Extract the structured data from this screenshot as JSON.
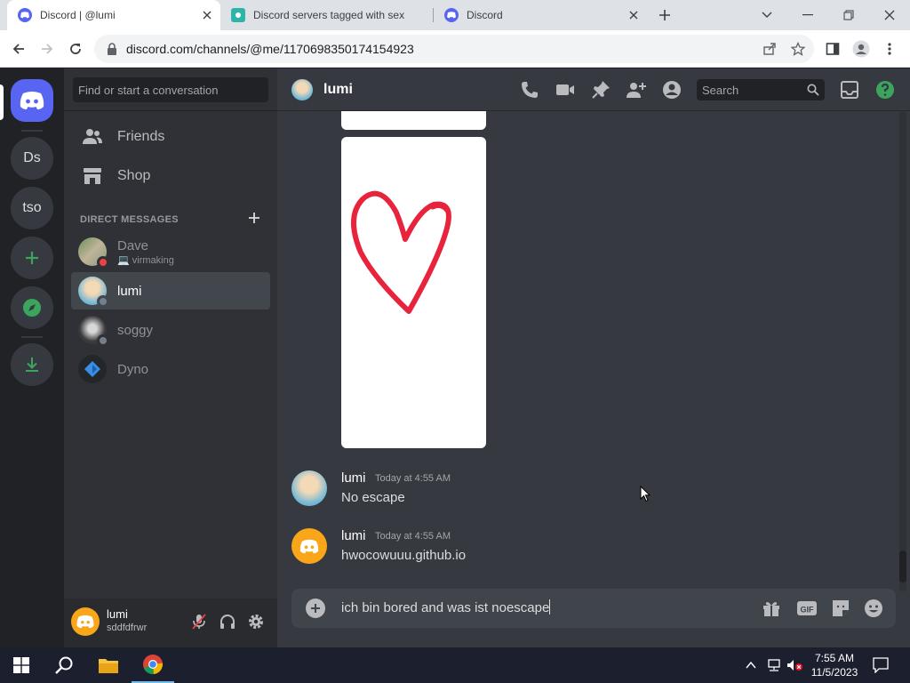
{
  "browser": {
    "tabs": [
      {
        "title": "Discord | @lumi",
        "active": true
      },
      {
        "title": "Discord servers tagged with sex",
        "active": false
      },
      {
        "title": "Discord",
        "active": false
      }
    ],
    "url": "discord.com/channels/@me/1170698350174154923"
  },
  "guilds": {
    "items": [
      {
        "label": "Ds",
        "name": "guild-ds"
      },
      {
        "label": "tso",
        "name": "guild-tso"
      }
    ]
  },
  "sidebar": {
    "search_placeholder": "Find or start a conversation",
    "nav": [
      {
        "label": "Friends"
      },
      {
        "label": "Shop"
      }
    ],
    "dm_header": "DIRECT MESSAGES",
    "dms": [
      {
        "name": "Dave",
        "status_text": "💻 virmaking",
        "status": "dnd",
        "selected": false
      },
      {
        "name": "lumi",
        "status_text": "",
        "status": "offline",
        "selected": true
      },
      {
        "name": "soggy",
        "status_text": "",
        "status": "offline",
        "selected": false
      },
      {
        "name": "Dyno",
        "status_text": "",
        "status": "none",
        "selected": false
      }
    ]
  },
  "user_panel": {
    "name": "lumi",
    "tag": "sddfdfrwr"
  },
  "chat": {
    "header_name": "lumi",
    "search_placeholder": "Search",
    "messages": [
      {
        "author": "lumi",
        "time": "Today at 4:55 AM",
        "text": "No escape"
      },
      {
        "author": "lumi",
        "time": "Today at 4:55 AM",
        "text": "hwocowuuu.github.io"
      }
    ],
    "composer_value": "ich bin bored and was ist noescape"
  },
  "taskbar": {
    "time": "7:55 AM",
    "date": "11/5/2023"
  },
  "colors": {
    "discord_blurple": "#5865f2",
    "green": "#3ba55d",
    "heart_red": "#e8243c",
    "dnd_red": "#ed4245"
  }
}
